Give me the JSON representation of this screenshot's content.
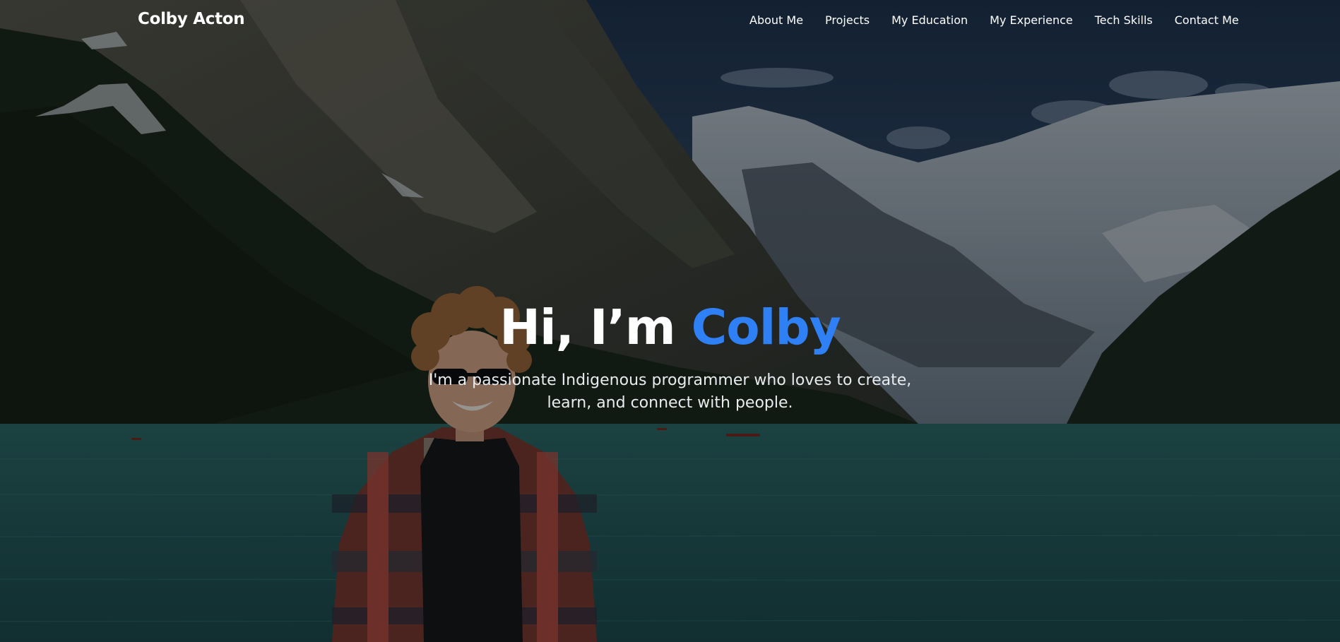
{
  "site": {
    "brand": "Colby Acton"
  },
  "nav": {
    "links": [
      {
        "label": "About Me"
      },
      {
        "label": "Projects"
      },
      {
        "label": "My Education"
      },
      {
        "label": "My Experience"
      },
      {
        "label": "Tech Skills"
      },
      {
        "label": "Contact Me"
      }
    ]
  },
  "hero": {
    "greeting": "Hi, I’m ",
    "name": "Colby",
    "tagline_line1": "I'm a passionate Indigenous programmer who loves to create,",
    "tagline_line2": "learn, and connect with people.",
    "background_image": "lake-mountain-photo",
    "portrait_image": "person-portrait-photo"
  },
  "colors": {
    "accent": "#2f80f4",
    "text": "#ffffff",
    "overlay": "rgba(0,0,0,0.45)"
  }
}
